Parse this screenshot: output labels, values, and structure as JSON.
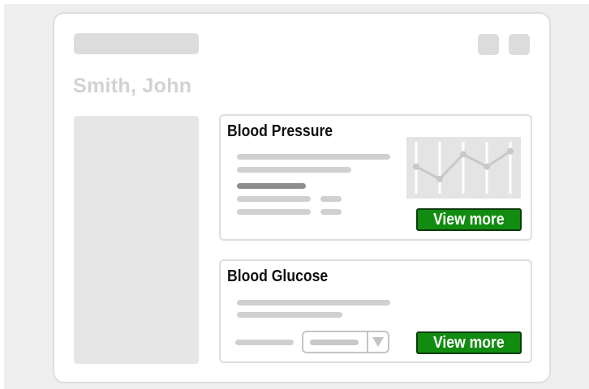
{
  "patient": {
    "name": "Smith, John"
  },
  "cards": {
    "blood_pressure": {
      "title": "Blood Pressure",
      "button_label": "View more"
    },
    "blood_glucose": {
      "title": "Blood Glucose",
      "button_label": "View more"
    }
  },
  "sparkline": {
    "values": [
      0.65,
      0.45,
      0.85,
      0.65,
      0.9
    ],
    "line_color": "#c8c8c8",
    "grid_color": "#ffffff"
  },
  "colors": {
    "accent": "#118c11",
    "placeholder": "#dcdcdc",
    "background": "#eeeeee"
  },
  "icons": {
    "select_arrow": "triangle-down-icon"
  }
}
